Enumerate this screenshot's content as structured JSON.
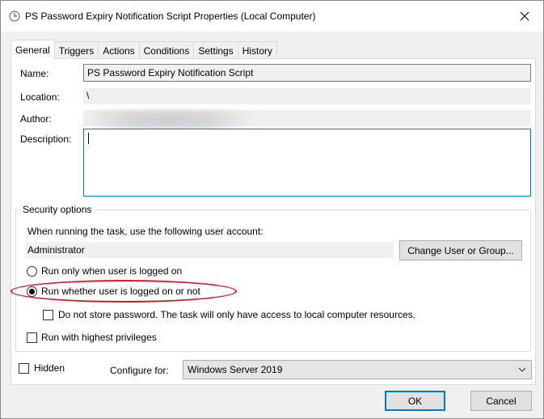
{
  "window": {
    "title": "PS Password Expiry Notification Script Properties (Local Computer)",
    "close_glyph": "✕"
  },
  "tabs": [
    {
      "label": "General",
      "active": true
    },
    {
      "label": "Triggers",
      "active": false
    },
    {
      "label": "Actions",
      "active": false
    },
    {
      "label": "Conditions",
      "active": false
    },
    {
      "label": "Settings",
      "active": false
    },
    {
      "label": "History",
      "active": false
    }
  ],
  "general": {
    "name_label": "Name:",
    "name_value": "PS Password Expiry Notification Script",
    "location_label": "Location:",
    "location_value": "\\",
    "author_label": "Author:",
    "description_label": "Description:",
    "description_value": ""
  },
  "security": {
    "group_title": "Security options",
    "account_prompt": "When running the task, use the following user account:",
    "account_value": "Administrator",
    "change_button": "Change User or Group...",
    "radio_logged_on": "Run only when user is logged on",
    "radio_whether": "Run whether user is logged on or not",
    "radio_selected": "whether",
    "no_store_password": "Do not store password.  The task will only have access to local computer resources.",
    "highest_privileges": "Run with highest privileges"
  },
  "footer": {
    "hidden_label": "Hidden",
    "configure_label": "Configure for:",
    "configure_value": "Windows Server 2019",
    "ok_button": "OK",
    "cancel_button": "Cancel"
  },
  "colors": {
    "focus_border": "#0078d7",
    "annotation_red": "#e0142a"
  },
  "icons": {
    "title": "clock-icon",
    "close": "close-icon",
    "dropdown": "chevron-down-icon"
  }
}
